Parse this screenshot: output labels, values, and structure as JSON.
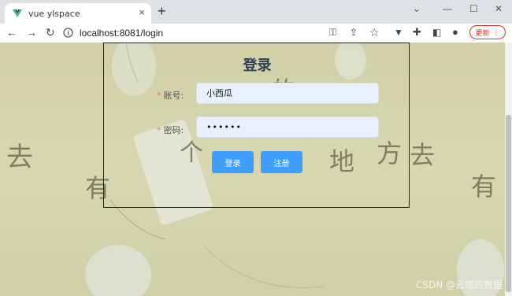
{
  "browser": {
    "tab_title": "vue ylspace",
    "tab_close": "×",
    "new_tab": "+",
    "url": "localhost:8081/login",
    "update_label": "更新",
    "menu_icon": "⋮"
  },
  "login": {
    "title": "登录",
    "username_label": "账号:",
    "username_value": "小西瓜",
    "password_label": "密码:",
    "password_value": "••••••",
    "required_mark": "*",
    "login_button": "登录",
    "register_button": "注册"
  },
  "background": {
    "chars": [
      "去",
      "有",
      "地",
      "方",
      "去",
      "有",
      "的",
      "个"
    ]
  },
  "watermark": "CSDN @云端的数据",
  "colors": {
    "primary_button": "#409eff",
    "input_fill": "#e8f0fe",
    "update_red": "#d93025"
  },
  "icons": [
    "vue-logo-icon",
    "back-icon",
    "forward-icon",
    "reload-icon",
    "info-icon",
    "key-icon",
    "share-icon",
    "star-icon",
    "extension-icon",
    "puzzle-icon",
    "sidepanel-icon",
    "profile-icon"
  ]
}
